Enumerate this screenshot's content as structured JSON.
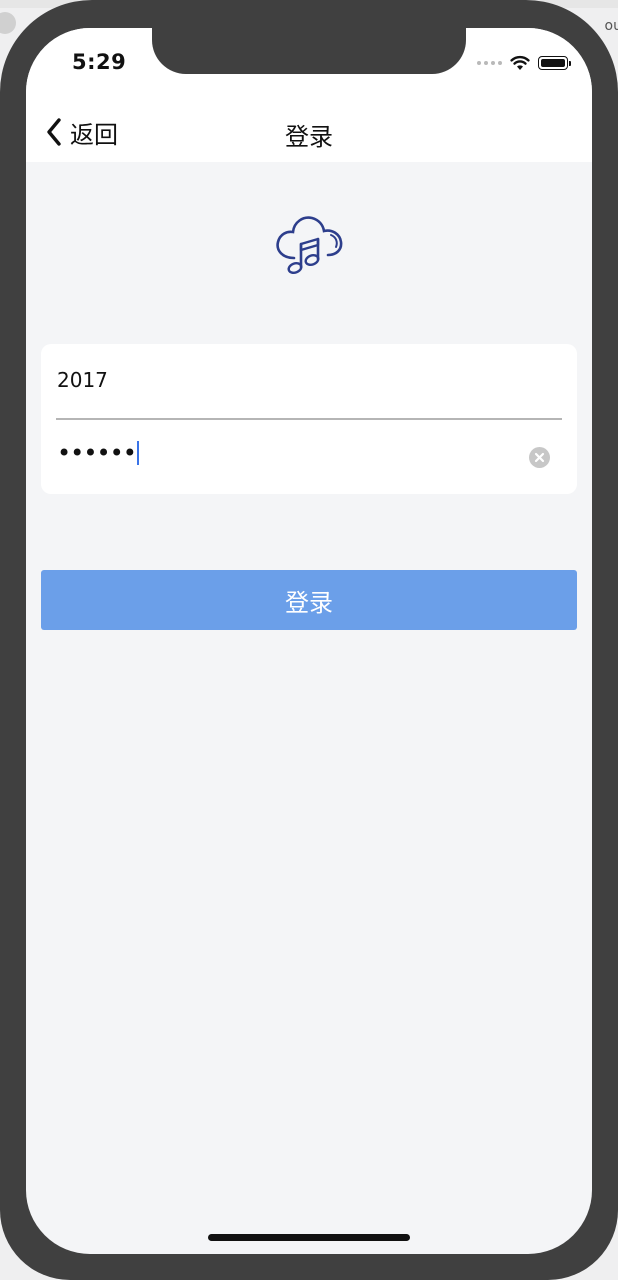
{
  "status_bar": {
    "time": "5:29"
  },
  "background": {
    "edge_text": "ou"
  },
  "navbar": {
    "back_label": "返回",
    "title": "登录"
  },
  "login_form": {
    "username_value": "2017",
    "password_masked": "••••••"
  },
  "login_button": {
    "label": "登录"
  },
  "colors": {
    "accent": "#6b9fe9",
    "logo_stroke": "#2d3e8c",
    "screen_bg": "#f4f5f7",
    "device_frame": "#404040"
  },
  "icons": {
    "back": "chevron-left-icon",
    "logo": "cloud-music-icon",
    "clear": "clear-icon",
    "wifi": "wifi-icon",
    "battery": "battery-icon"
  }
}
